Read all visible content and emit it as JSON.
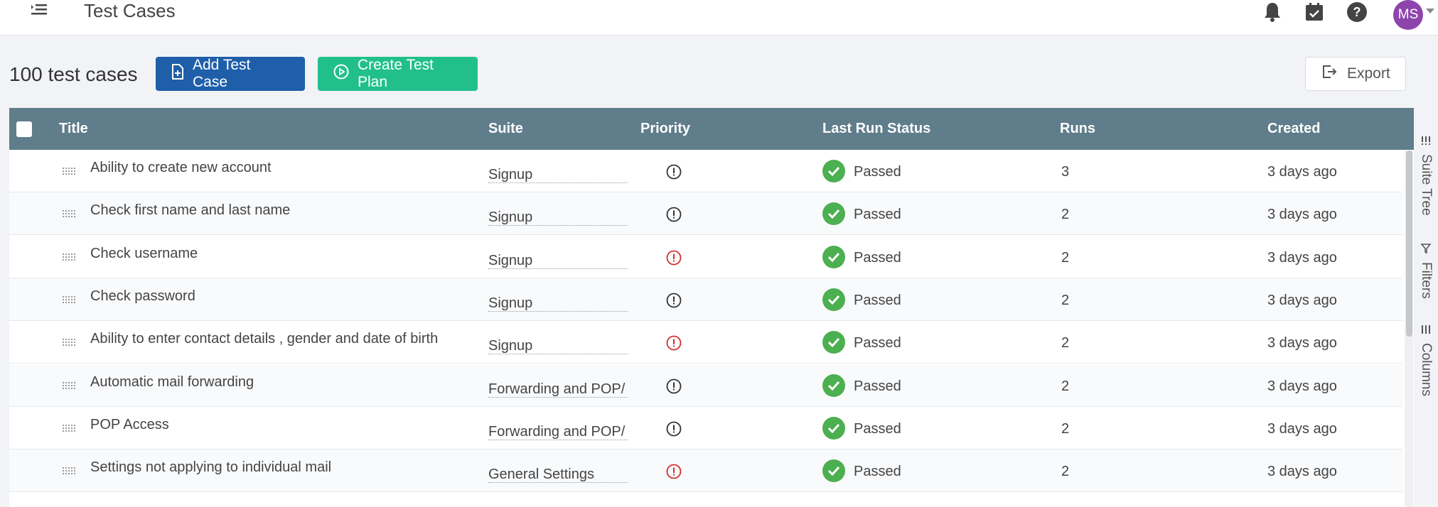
{
  "header": {
    "title": "Test Cases",
    "avatar_initials": "MS"
  },
  "toolbar": {
    "count_label": "100 test cases",
    "add_label": "Add Test Case",
    "plan_label": "Create Test Plan",
    "export_label": "Export"
  },
  "table": {
    "columns": {
      "title": "Title",
      "suite": "Suite",
      "priority": "Priority",
      "status": "Last Run Status",
      "runs": "Runs",
      "created": "Created"
    },
    "rows": [
      {
        "title": "Ability to create new account",
        "suite": "Signup",
        "priority": "normal",
        "status": "Passed",
        "runs": "3",
        "created": "3 days ago"
      },
      {
        "title": "Check first name and last name",
        "suite": "Signup",
        "priority": "normal",
        "status": "Passed",
        "runs": "2",
        "created": "3 days ago"
      },
      {
        "title": "Check username",
        "suite": "Signup",
        "priority": "high",
        "status": "Passed",
        "runs": "2",
        "created": "3 days ago"
      },
      {
        "title": "Check password",
        "suite": "Signup",
        "priority": "normal",
        "status": "Passed",
        "runs": "2",
        "created": "3 days ago"
      },
      {
        "title": "Ability to enter contact details , gender and date of birth",
        "suite": "Signup",
        "priority": "high",
        "status": "Passed",
        "runs": "2",
        "created": "3 days ago"
      },
      {
        "title": "Automatic mail forwarding",
        "suite": "Forwarding and POP/",
        "priority": "normal",
        "status": "Passed",
        "runs": "2",
        "created": "3 days ago"
      },
      {
        "title": "POP Access",
        "suite": "Forwarding and POP/",
        "priority": "normal",
        "status": "Passed",
        "runs": "2",
        "created": "3 days ago"
      },
      {
        "title": "Settings not applying to individual mail",
        "suite": "General Settings",
        "priority": "high",
        "status": "Passed",
        "runs": "2",
        "created": "3 days ago"
      }
    ]
  },
  "side_panel": {
    "suite_tree": "Suite Tree",
    "filters": "Filters",
    "columns": "Columns"
  },
  "colors": {
    "header_bg": "#607d8b",
    "primary": "#1f5ea8",
    "success": "#21c08b",
    "passed": "#4caf50",
    "priority_high": "#d32f2f",
    "avatar": "#8e44ad"
  }
}
